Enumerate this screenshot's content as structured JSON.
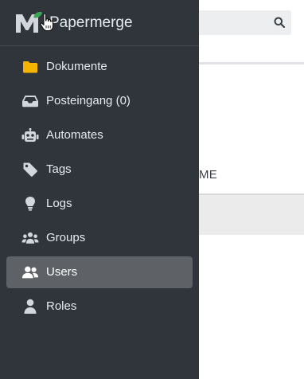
{
  "app": {
    "title": "Papermerge"
  },
  "nav": {
    "items": [
      {
        "label": "Dokumente",
        "icon": "folder-icon"
      },
      {
        "label": "Posteingang (0)",
        "icon": "inbox-icon"
      },
      {
        "label": "Automates",
        "icon": "robot-icon"
      },
      {
        "label": "Tags",
        "icon": "tag-icon"
      },
      {
        "label": "Logs",
        "icon": "lightbulb-icon"
      },
      {
        "label": "Groups",
        "icon": "users-group-icon"
      },
      {
        "label": "Users",
        "icon": "users-icon",
        "active": true
      },
      {
        "label": "Roles",
        "icon": "user-icon"
      }
    ]
  },
  "background": {
    "column_header": "ME",
    "search_icon": "search-icon"
  },
  "colors": {
    "sidebar": "#2f353a",
    "active_item": "#5e6165",
    "folder": "#f4b400",
    "icon": "#d3d7dc",
    "logo_leaf": "#3aa655"
  }
}
